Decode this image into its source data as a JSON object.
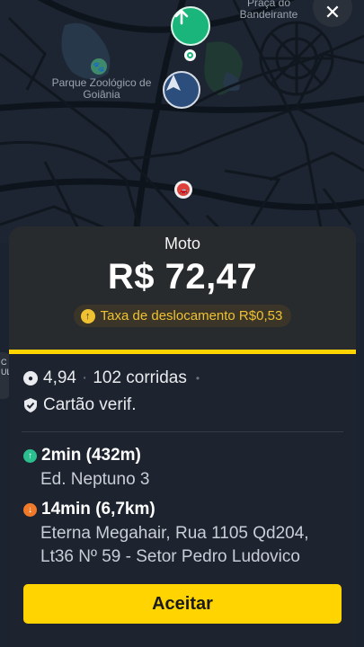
{
  "map": {
    "labels": {
      "zoo": "Parque Zoológico de Goiânia",
      "praca": "Praça do Bandeirante"
    },
    "icons": {
      "close": "close-icon",
      "pickup": "arrow-up-icon",
      "navigation": "navigation-arrow-icon",
      "car": "car-icon",
      "zoo": "paw-icon"
    }
  },
  "side_stub": {
    "text": "C\nUL"
  },
  "offer": {
    "service": "Moto",
    "price": "R$ 72,47",
    "fee_label": "Taxa de deslocamento R$0,53",
    "rating": "4,94",
    "rides": "102 corridas",
    "verified": "Cartão verif.",
    "pickup": {
      "eta": "2min (432m)",
      "address": "Ed. Neptuno 3"
    },
    "dropoff": {
      "eta": "14min (6,7km)",
      "address": "Eterna Megahair, Rua 1105 Qd204, Lt36 Nº 59 - Setor Pedro Ludovico"
    },
    "accept_label": "Aceitar"
  },
  "colors": {
    "accent": "#ffd400",
    "pickup_green": "#19b57b",
    "dropoff_orange": "#f07a2a",
    "fee_text": "#f0c232"
  }
}
